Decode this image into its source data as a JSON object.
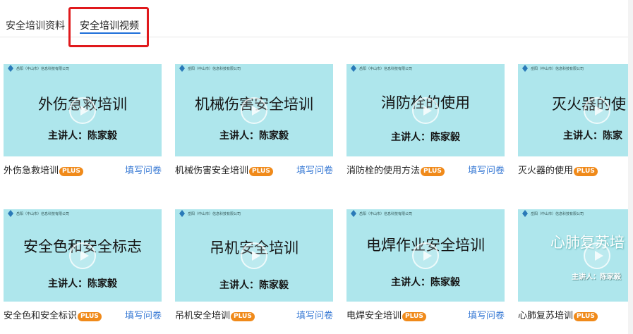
{
  "tabs": [
    {
      "label": "安全培训资料",
      "active": false
    },
    {
      "label": "安全培训视频",
      "active": true
    }
  ],
  "colors": {
    "thumb_bg": "#aee6ec",
    "accent": "#1e6fd9",
    "link": "#3a7bd5",
    "plus_badge": "#f08a1a",
    "highlight": "#e0191c"
  },
  "company": "岳阳（中山市）信息科技有限公司",
  "plus_label": "PLUS",
  "fill_label": "填写问卷",
  "videos": [
    {
      "title": "外伤急救培训",
      "speaker": "主讲人：陈家毅",
      "caption": "外伤急救培训",
      "fill": true
    },
    {
      "title": "机械伤害安全培训",
      "speaker": "主讲人：陈家毅",
      "caption": "机械伤害安全培训",
      "fill": true
    },
    {
      "title": "消防栓的使用",
      "speaker": "主讲人：陈家毅",
      "caption": "消防栓的使用方法",
      "fill": true
    },
    {
      "title": "灭火器的使",
      "speaker": "主讲人：陈家",
      "caption": "灭火器的使用",
      "fill": false
    },
    {
      "title": "安全色和安全标志",
      "speaker": "主讲人：陈家毅",
      "caption": "安全色和安全标识",
      "fill": true
    },
    {
      "title": "吊机安全培训",
      "speaker": "主讲人：陈家毅",
      "caption": "吊机安全培训",
      "fill": true
    },
    {
      "title": "电焊作业安全培训",
      "speaker": "主讲人：陈家毅",
      "caption": "电焊安全培训",
      "fill": true
    },
    {
      "title": "心肺复苏培",
      "speaker": "主讲人：陈家毅",
      "caption": "心肺复苏培训",
      "fill": false
    }
  ]
}
